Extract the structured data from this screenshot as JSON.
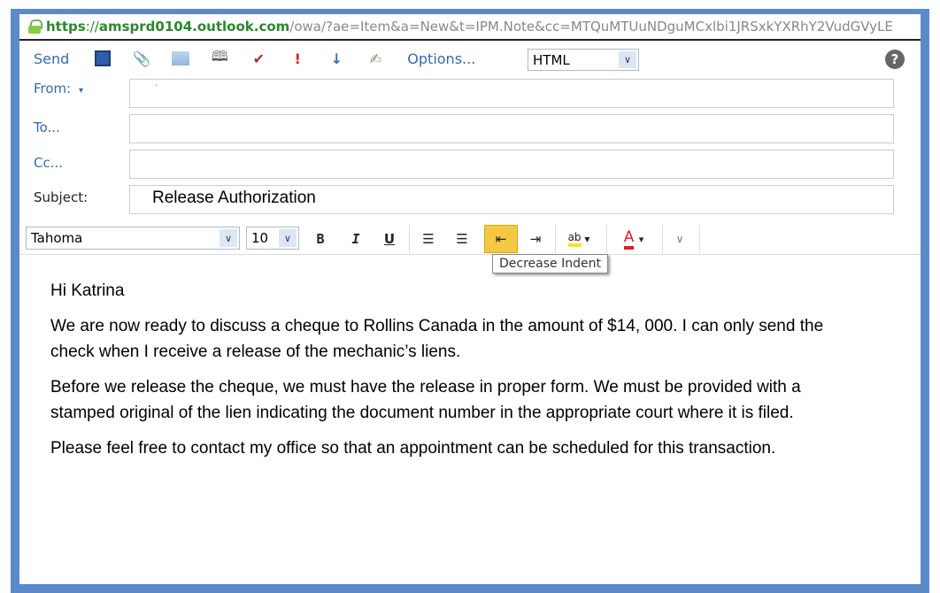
{
  "address_bar": {
    "scheme": "https",
    "separator": "://",
    "host": "amsprd0104.outlook.com",
    "path": "/owa/?ae=Item&a=New&t=IPM.Note&cc=MTQuMTUuNDguMCxlbi1JRSxkYXRhY2VudGVyLE"
  },
  "toolbar": {
    "send_label": "Send",
    "options_label": "Options...",
    "format_value": "HTML",
    "icons": [
      "save-icon",
      "attach-icon",
      "insert-picture-icon",
      "address-book-icon",
      "check-names-icon",
      "high-importance-icon",
      "low-importance-icon",
      "signature-icon",
      "help-icon"
    ]
  },
  "fields": {
    "from_label": "From:",
    "from_value": "´",
    "to_label": "To...",
    "to_value": "",
    "cc_label": "Cc...",
    "cc_value": "",
    "subject_label": "Subject:",
    "subject_value": "Release Authorization"
  },
  "format_toolbar": {
    "font": "Tahoma",
    "size": "10",
    "bold": "B",
    "italic": "I",
    "underline": "U",
    "tooltip": "Decrease Indent",
    "active_button": "decrease-indent",
    "highlight_color": "#f5e61a",
    "font_color": "#d9202a",
    "active_bg": "#f5c842"
  },
  "body": {
    "paragraphs": [
      "Hi Katrina",
      "We are now ready to discuss a cheque to Rollins Canada in the amount of $14, 000.  I can only send the check when I receive a release of the mechanic’s liens.",
      "Before we release the cheque, we must have the release in proper form.  We must be provided with a stamped original of the lien indicating the document number in the appropriate court where it is filed.",
      "Please feel free to contact my office so that an appointment can be scheduled for this transaction."
    ]
  }
}
